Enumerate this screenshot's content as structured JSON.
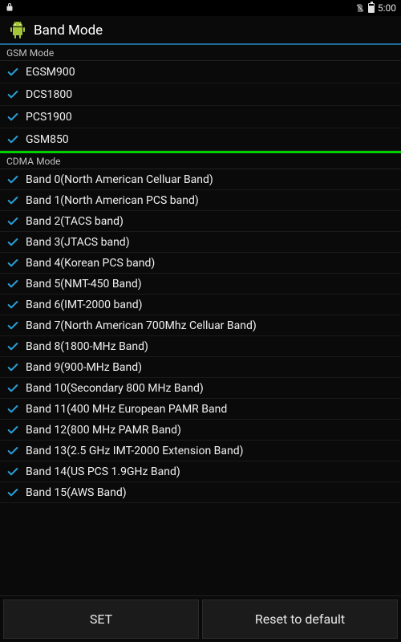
{
  "status": {
    "time": "5:00"
  },
  "header": {
    "title": "Band Mode"
  },
  "sections": {
    "gsm": {
      "title": "GSM Mode",
      "items": [
        {
          "label": "EGSM900",
          "checked": true
        },
        {
          "label": "DCS1800",
          "checked": true
        },
        {
          "label": "PCS1900",
          "checked": true
        },
        {
          "label": "GSM850",
          "checked": true
        }
      ]
    },
    "cdma": {
      "title": "CDMA Mode",
      "items": [
        {
          "label": "Band 0(North American Celluar Band)",
          "checked": true
        },
        {
          "label": "Band 1(North American PCS band)",
          "checked": true
        },
        {
          "label": "Band 2(TACS band)",
          "checked": true
        },
        {
          "label": "Band 3(JTACS band)",
          "checked": true
        },
        {
          "label": "Band 4(Korean PCS band)",
          "checked": true
        },
        {
          "label": "Band 5(NMT-450 Band)",
          "checked": true
        },
        {
          "label": "Band 6(IMT-2000 band)",
          "checked": true
        },
        {
          "label": "Band 7(North American 700Mhz Celluar Band)",
          "checked": true
        },
        {
          "label": "Band 8(1800-MHz Band)",
          "checked": true
        },
        {
          "label": "Band 9(900-MHz Band)",
          "checked": true
        },
        {
          "label": "Band 10(Secondary 800 MHz Band)",
          "checked": true
        },
        {
          "label": "Band 11(400 MHz European PAMR Band",
          "checked": true
        },
        {
          "label": "Band 12(800 MHz PAMR Band)",
          "checked": true
        },
        {
          "label": "Band 13(2.5 GHz IMT-2000 Extension Band)",
          "checked": true
        },
        {
          "label": "Band 14(US PCS 1.9GHz Band)",
          "checked": true
        },
        {
          "label": "Band 15(AWS Band)",
          "checked": true
        }
      ]
    }
  },
  "buttons": {
    "set": "SET",
    "reset": "Reset to default"
  },
  "colors": {
    "accent": "#2aa0d8",
    "separator": "#00d000"
  }
}
